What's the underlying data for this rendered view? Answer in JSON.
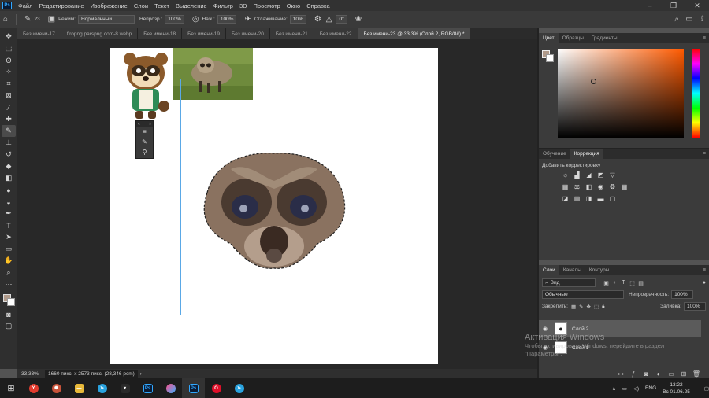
{
  "app": {
    "logo": "Ps",
    "menu": [
      "Файл",
      "Редактирование",
      "Изображение",
      "Слои",
      "Текст",
      "Выделение",
      "Фильтр",
      "3D",
      "Просмотр",
      "Окно",
      "Справка"
    ],
    "window_controls": [
      "–",
      "❐",
      "✕"
    ]
  },
  "options": {
    "brush_size": "23",
    "mode_label": "Режим:",
    "mode_value": "Нормальный",
    "opacity_label": "Непрозр.:",
    "opacity_value": "100%",
    "pressure_label": "Наж.:",
    "pressure_value": "100%",
    "smoothing_label": "Сглаживание:",
    "smoothing_value": "10%",
    "angle_value": "0°"
  },
  "tabs": [
    {
      "label": "Без имени-17"
    },
    {
      "label": "firopng.parspng.com-8.webp"
    },
    {
      "label": "Без имени-18"
    },
    {
      "label": "Без имени-19"
    },
    {
      "label": "Без имени-20"
    },
    {
      "label": "Без имени-21"
    },
    {
      "label": "Без имени-22"
    },
    {
      "label": "Без имени-23 @ 33,3% (Слой 2, RGB/8#) *"
    }
  ],
  "status": {
    "zoom": "33,33%",
    "info": "1660 пикс. x 2573 пикс. (28,346 pcm)"
  },
  "panels": {
    "color_tabs": [
      "Цвет",
      "Образцы",
      "Градиенты"
    ],
    "adjust_tabs": [
      "Обучение",
      "Коррекция"
    ],
    "adjust_add_label": "Добавить корректировку",
    "layers_tabs": [
      "Слои",
      "Каналы",
      "Контуры"
    ],
    "layers_filter": "Вид",
    "blend_mode": "Обычные",
    "layer_opacity_label": "Непрозрачность:",
    "layer_opacity_value": "100%",
    "lock_label": "Закрепить:",
    "fill_label": "Заливка:",
    "fill_value": "100%",
    "layers": [
      {
        "name": "Слой 2"
      },
      {
        "name": "Слой 1"
      }
    ]
  },
  "watermark": {
    "title": "Активация Windows",
    "line1": "Чтобы активировать Windows, перейдите в раздел",
    "line2": "\"Параметры\"."
  },
  "taskbar": {
    "lang": "ENG",
    "time": "13:22",
    "date": "Вс 01.06.25"
  },
  "colors": {
    "foreground": "#b09a8a",
    "background": "#ffffff",
    "accent": "#31a8ff",
    "guide": "#5aa8e6"
  }
}
